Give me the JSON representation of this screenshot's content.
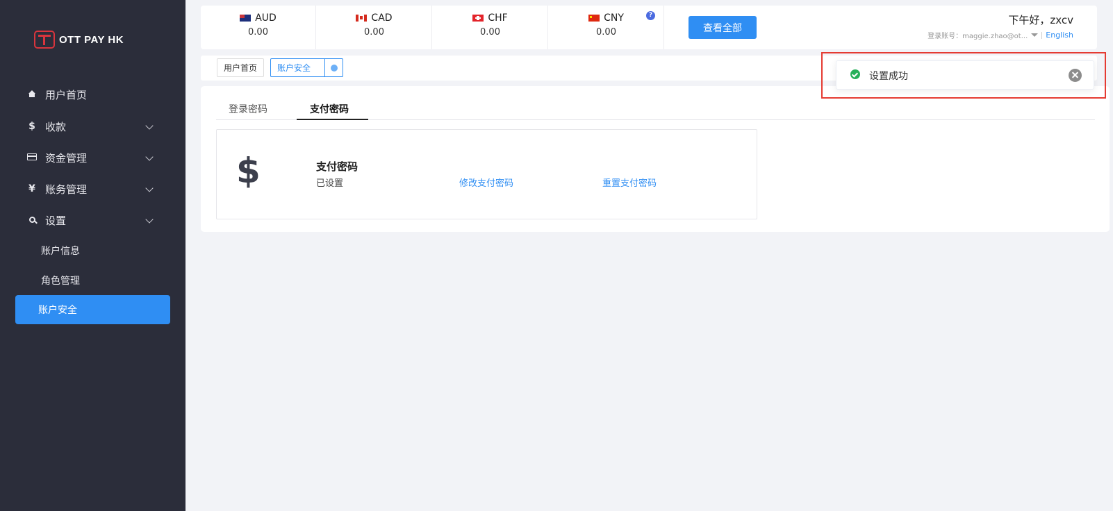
{
  "brand": {
    "name": "OTT PAY HK"
  },
  "sidebar": {
    "items": [
      {
        "label": "用户首页"
      },
      {
        "label": "收款"
      },
      {
        "label": "资金管理"
      },
      {
        "label": "账务管理"
      },
      {
        "label": "设置"
      }
    ],
    "icons": {
      "home": "$",
      "payment": "$",
      "funds": "",
      "accounting": "¥",
      "settings": ""
    },
    "sub_items": [
      {
        "label": "账户信息"
      },
      {
        "label": "角色管理"
      },
      {
        "label": "账户安全"
      }
    ]
  },
  "currencies": [
    {
      "code": "AUD",
      "value": "0.00"
    },
    {
      "code": "CAD",
      "value": "0.00"
    },
    {
      "code": "CHF",
      "value": "0.00"
    },
    {
      "code": "CNY",
      "value": "0.00"
    }
  ],
  "header": {
    "help": "?",
    "view_all_label": "查看全部",
    "greeting": "下午好，zxcv",
    "account_label": "登录账号：maggie.zhao@ot...",
    "language": "English"
  },
  "page_tabs": [
    {
      "label": "用户首页"
    },
    {
      "label": "账户安全"
    }
  ],
  "security": {
    "tabs": [
      {
        "label": "登录密码"
      },
      {
        "label": "支付密码"
      }
    ],
    "card": {
      "symbol": "$",
      "title": "支付密码",
      "status": "已设置",
      "modify_label": "修改支付密码",
      "reset_label": "重置支付密码"
    }
  },
  "toast": {
    "message": "设置成功"
  },
  "colors": {
    "accent": "#2f8ef3",
    "sidebar_bg": "#2b2d3a",
    "success": "#27b05a",
    "highlight": "#e53b32"
  }
}
